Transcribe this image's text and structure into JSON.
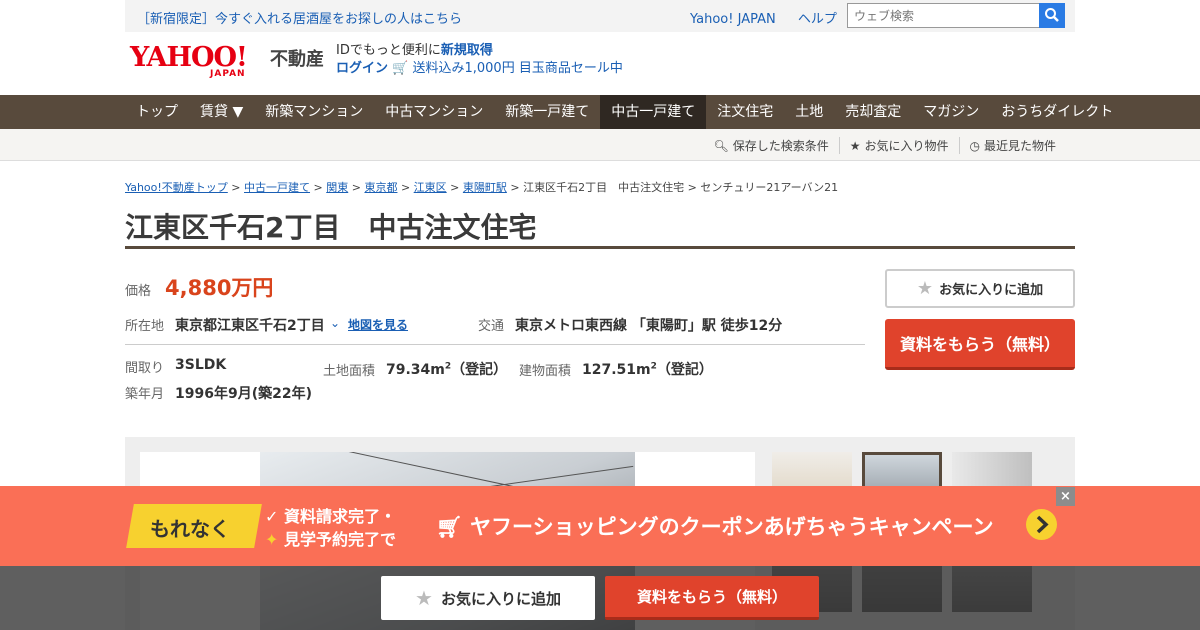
{
  "topbar": {
    "promo": "［新宿限定］今すぐ入れる居酒屋をお探しの人はこちら",
    "links": [
      "Yahoo! JAPAN",
      "ヘルプ"
    ],
    "search_placeholder": "ウェブ検索"
  },
  "header": {
    "logo_main": "YAHOO!",
    "logo_sub": "JAPAN",
    "logo_service": "不動産",
    "id_text": "IDでもっと便利に",
    "signup": "新規取得",
    "login": "ログイン",
    "sale": "送料込み1,000円 目玉商品セール中"
  },
  "nav": {
    "items": [
      "トップ",
      "賃貸 ▼",
      "新築マンション",
      "中古マンション",
      "新築一戸建て",
      "中古一戸建て",
      "注文住宅",
      "土地",
      "売却査定",
      "マガジン",
      "おうちダイレクト"
    ],
    "active_index": 5
  },
  "subnav": {
    "saved_search": "保存した検索条件",
    "favorites": "お気に入り物件",
    "recent": "最近見た物件"
  },
  "breadcrumb": {
    "links": [
      "Yahoo!不動産トップ",
      "中古一戸建て",
      "関東",
      "東京都",
      "江東区",
      "東陽町駅"
    ],
    "current": "江東区千石2丁目　中古注文住宅 > センチュリー21アーバン21"
  },
  "property": {
    "title": "江東区千石2丁目　中古注文住宅",
    "price_label": "価格",
    "price": "4,880万円",
    "location_label": "所在地",
    "location": "東京都江東区千石2丁目",
    "map_link": "地図を見る",
    "access_label": "交通",
    "access": "東京メトロ東西線 「東陽町」駅 徒歩12分",
    "layout_label": "間取り",
    "layout": "3SLDK",
    "land_label": "土地面積",
    "land_area": "79.34m",
    "land_note": "（登記）",
    "building_label": "建物面積",
    "building_area": "127.51m",
    "building_note": "（登記）",
    "built_label": "築年月",
    "built": "1996年9月(築22年)",
    "sup": "2"
  },
  "actions": {
    "favorite": "お気に入りに追加",
    "request": "資料をもらう（無料）"
  },
  "banner": {
    "tag": "もれなく",
    "done_line1": "資料請求完了・",
    "done_line2": "見学予約完了で",
    "main": "ヤフーショッピングのクーポンあげちゃうキャンペーン",
    "close": "×"
  },
  "sticky": {
    "favorite": "お気に入りに追加",
    "request": "資料をもらう（無料）"
  },
  "colors": {
    "nav_bg": "#584a3c",
    "price": "#d9441c",
    "request_button": "#e0432c",
    "banner_bg": "#fa6f56",
    "banner_tag": "#f7d12f",
    "link": "#1a5fb4"
  }
}
